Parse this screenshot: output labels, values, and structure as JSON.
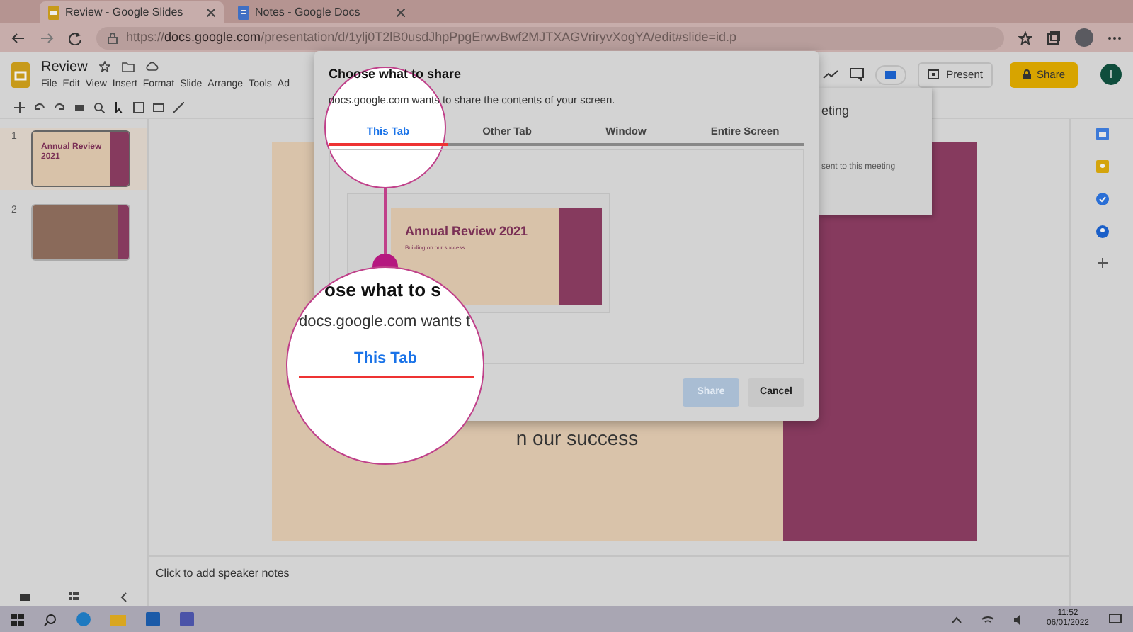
{
  "browser": {
    "tabs": [
      {
        "title": "Review - Google Slides",
        "selected": true
      },
      {
        "title": "Notes - Google Docs",
        "selected": false
      }
    ],
    "url_scheme": "https://",
    "url_host": "docs.google.com",
    "url_path": "/presentation/d/1ylj0T2lB0usdJhpPpgErwvBwf2MJTXAGVriryvXogYA/edit#slide=id.p"
  },
  "app": {
    "doc_title": "Review",
    "menu": [
      "File",
      "Edit",
      "View",
      "Insert",
      "Format",
      "Slide",
      "Arrange",
      "Tools",
      "Ad"
    ],
    "present": "Present",
    "share": "Share",
    "avatar": "I"
  },
  "filmstrip": [
    {
      "number": "1",
      "kind": "title",
      "title": "Annual Review 2021",
      "selected": true
    },
    {
      "number": "2",
      "kind": "photo",
      "selected": false
    }
  ],
  "slide": {
    "visible_text": "n our success"
  },
  "meeting_popup": {
    "title": "eting",
    "text": "sent to this meeting"
  },
  "dialog": {
    "title": "Choose what to share",
    "message": "docs.google.com wants to share the contents of your screen.",
    "tabs": [
      {
        "label": "This Tab",
        "selected": true
      },
      {
        "label": "Other Tab",
        "selected": false
      },
      {
        "label": "Window",
        "selected": false
      },
      {
        "label": "Entire Screen",
        "selected": false
      }
    ],
    "preview": {
      "title": "Annual Review 2021",
      "subtitle": "Building on our success"
    },
    "buttons": [
      {
        "label": "Share",
        "disabled": true
      },
      {
        "label": "Cancel",
        "disabled": false
      }
    ]
  },
  "magnifier": {
    "heading_fragment": "ose what to s",
    "message_fragment": "docs.google.com wants t",
    "tab_label": "This Tab"
  },
  "speaker_notes": {
    "placeholder": "Click to add speaker notes"
  },
  "taskbar": {
    "time": "11:52",
    "date": "06/01/2022"
  }
}
